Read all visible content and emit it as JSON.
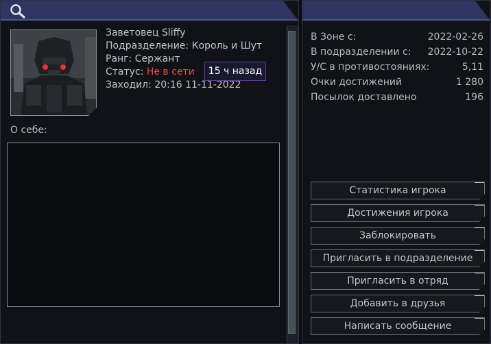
{
  "header": {
    "search_icon": "search-icon"
  },
  "profile": {
    "name": "Заветовец Sliffy",
    "unit_label": "Подразделение:",
    "unit_value": "Король и Шут",
    "rank_label": "Ранг:",
    "rank_value": "Сержант",
    "status_label": "Статус:",
    "status_value": "Не в сети",
    "status_color": "#ee4a3f",
    "last_seen_label": "Заходил:",
    "last_seen_value": "20:16 11-11-2022",
    "tooltip": "15 ч назад"
  },
  "about": {
    "label": "О себе:",
    "text": ""
  },
  "stats": [
    {
      "label": "В Зоне с:",
      "value": "2022-02-26"
    },
    {
      "label": "В подразделении с:",
      "value": "2022-10-22"
    },
    {
      "label": "У/С в противостояниях:",
      "value": "5,11"
    },
    {
      "label": "Очки достижений",
      "value": "1 280"
    },
    {
      "label": "Посылок доставлено",
      "value": "196"
    }
  ],
  "buttons": [
    "Статистика игрока",
    "Достижения игрока",
    "Заблокировать",
    "Пригласить в подразделение",
    "Пригласить в отряд",
    "Добавить в друзья",
    "Написать сообщение"
  ],
  "colors": {
    "header": "#2d3560",
    "panel": "#101218",
    "accent_border": "#4c578e"
  }
}
